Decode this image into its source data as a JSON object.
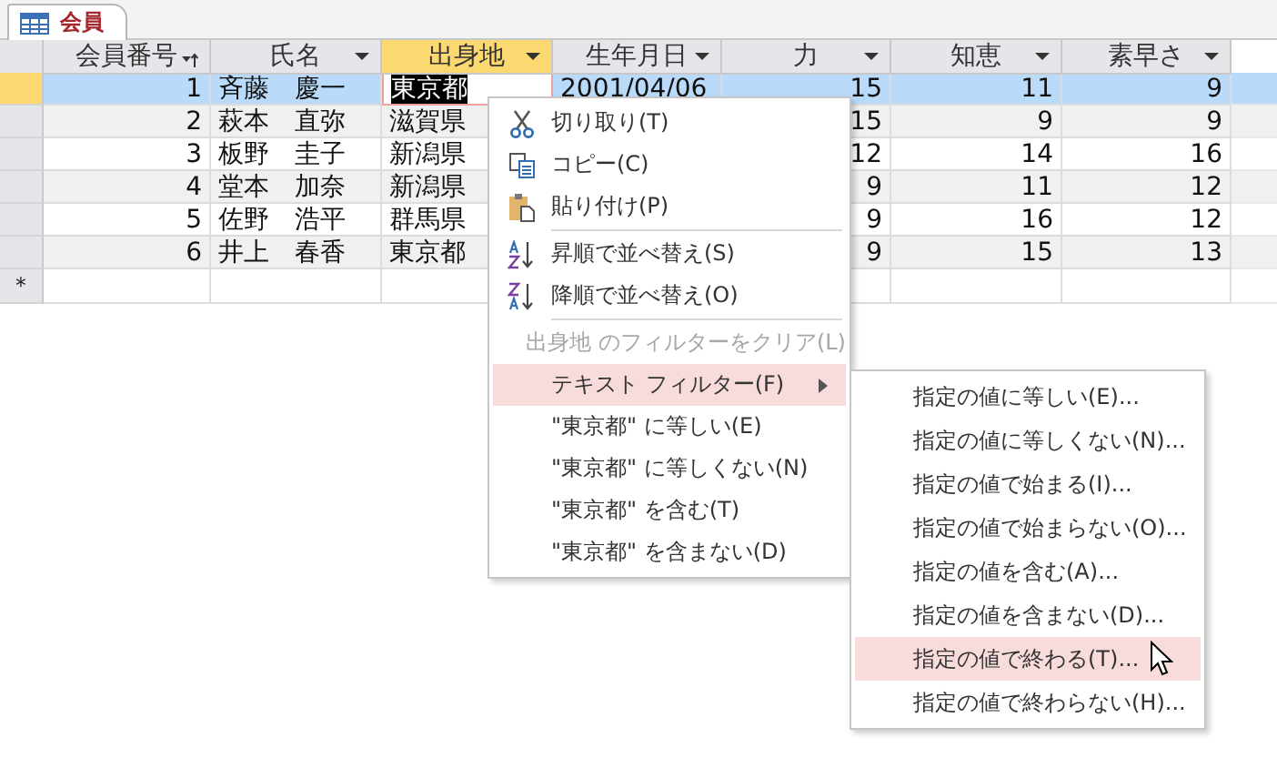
{
  "tab": {
    "label": "会員",
    "selected": true
  },
  "table": {
    "columns": [
      {
        "label": "会員番号",
        "sorted": true,
        "selected": false
      },
      {
        "label": "氏名",
        "sorted": false,
        "selected": false
      },
      {
        "label": "出身地",
        "sorted": false,
        "selected": true
      },
      {
        "label": "生年月日",
        "sorted": false,
        "selected": false
      },
      {
        "label": "力",
        "sorted": false,
        "selected": false
      },
      {
        "label": "知恵",
        "sorted": false,
        "selected": false
      },
      {
        "label": "素早さ",
        "sorted": false,
        "selected": false
      }
    ],
    "rows": [
      {
        "selected": true,
        "number": "1",
        "name": "斉藤　慶一",
        "origin": "東京都",
        "birth_date": "2001/04/06",
        "power": "15",
        "wisdom": "11",
        "speed": "9"
      },
      {
        "selected": false,
        "number": "2",
        "name": "萩本　直弥",
        "origin": "滋賀県",
        "power": "15",
        "wisdom": "9",
        "speed": "9"
      },
      {
        "selected": false,
        "number": "3",
        "name": "板野　圭子",
        "origin": "新潟県",
        "power": "12",
        "wisdom": "14",
        "speed": "16"
      },
      {
        "selected": false,
        "number": "4",
        "name": "堂本　加奈",
        "origin": "新潟県",
        "power": "9",
        "wisdom": "11",
        "speed": "12"
      },
      {
        "selected": false,
        "number": "5",
        "name": "佐野　浩平",
        "origin": "群馬県",
        "power": "9",
        "wisdom": "16",
        "speed": "12"
      },
      {
        "selected": false,
        "number": "6",
        "name": "井上　春香",
        "origin": "東京都",
        "power": "9",
        "wisdom": "15",
        "speed": "13"
      }
    ],
    "new_row_marker": "＊"
  },
  "context_menu": {
    "items": [
      {
        "kind": "item",
        "label": "切り取り(T)",
        "disabled": false,
        "highlighted": false,
        "submenu": false
      },
      {
        "kind": "item",
        "label": "コピー(C)",
        "disabled": false,
        "highlighted": false,
        "submenu": false
      },
      {
        "kind": "item",
        "label": "貼り付け(P)",
        "disabled": false,
        "highlighted": false,
        "submenu": false
      },
      {
        "kind": "separator"
      },
      {
        "kind": "item",
        "label": "昇順で並べ替え(S)",
        "disabled": false,
        "highlighted": false,
        "submenu": false
      },
      {
        "kind": "item",
        "label": "降順で並べ替え(O)",
        "disabled": false,
        "highlighted": false,
        "submenu": false
      },
      {
        "kind": "separator"
      },
      {
        "kind": "item",
        "label": "出身地 のフィルターをクリア(L)",
        "disabled": true,
        "highlighted": false,
        "submenu": false
      },
      {
        "kind": "item",
        "label": "テキスト フィルター(F)",
        "disabled": false,
        "highlighted": true,
        "submenu": true
      },
      {
        "kind": "item",
        "label": "\"東京都\" に等しい(E)",
        "disabled": false,
        "highlighted": false,
        "submenu": false
      },
      {
        "kind": "item",
        "label": "\"東京都\" に等しくない(N)",
        "disabled": false,
        "highlighted": false,
        "submenu": false
      },
      {
        "kind": "item",
        "label": "\"東京都\" を含む(T)",
        "disabled": false,
        "highlighted": false,
        "submenu": false
      },
      {
        "kind": "item",
        "label": "\"東京都\" を含まない(D)",
        "disabled": false,
        "highlighted": false,
        "submenu": false
      }
    ]
  },
  "submenu": {
    "items": [
      {
        "label": "指定の値に等しい(E)...",
        "highlighted": false
      },
      {
        "label": "指定の値に等しくない(N)...",
        "highlighted": false
      },
      {
        "label": "指定の値で始まる(I)...",
        "highlighted": false
      },
      {
        "label": "指定の値で始まらない(O)...",
        "highlighted": false
      },
      {
        "label": "指定の値を含む(A)...",
        "highlighted": false
      },
      {
        "label": "指定の値を含まない(D)...",
        "highlighted": false
      },
      {
        "label": "指定の値で終わる(T)...",
        "highlighted": true
      },
      {
        "label": "指定の値で終わらない(H)...",
        "highlighted": false
      }
    ]
  }
}
